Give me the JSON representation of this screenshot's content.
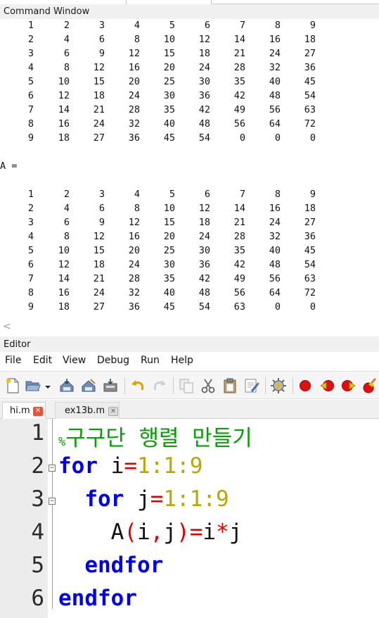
{
  "command_window": {
    "title": "Command Window",
    "matrix1": [
      [
        "1",
        "2",
        "3",
        "4",
        "5",
        "6",
        "7",
        "8",
        "9"
      ],
      [
        "2",
        "4",
        "6",
        "8",
        "10",
        "12",
        "14",
        "16",
        "18"
      ],
      [
        "3",
        "6",
        "9",
        "12",
        "15",
        "18",
        "21",
        "24",
        "27"
      ],
      [
        "4",
        "8",
        "12",
        "16",
        "20",
        "24",
        "28",
        "32",
        "36"
      ],
      [
        "5",
        "10",
        "15",
        "20",
        "25",
        "30",
        "35",
        "40",
        "45"
      ],
      [
        "6",
        "12",
        "18",
        "24",
        "30",
        "36",
        "42",
        "48",
        "54"
      ],
      [
        "7",
        "14",
        "21",
        "28",
        "35",
        "42",
        "49",
        "56",
        "63"
      ],
      [
        "8",
        "16",
        "24",
        "32",
        "40",
        "48",
        "56",
        "64",
        "72"
      ],
      [
        "9",
        "18",
        "27",
        "36",
        "45",
        "54",
        "0",
        "0",
        "0"
      ]
    ],
    "assign_label": "A =",
    "matrix2": [
      [
        "1",
        "2",
        "3",
        "4",
        "5",
        "6",
        "7",
        "8",
        "9"
      ],
      [
        "2",
        "4",
        "6",
        "8",
        "10",
        "12",
        "14",
        "16",
        "18"
      ],
      [
        "3",
        "6",
        "9",
        "12",
        "15",
        "18",
        "21",
        "24",
        "27"
      ],
      [
        "4",
        "8",
        "12",
        "16",
        "20",
        "24",
        "28",
        "32",
        "36"
      ],
      [
        "5",
        "10",
        "15",
        "20",
        "25",
        "30",
        "35",
        "40",
        "45"
      ],
      [
        "6",
        "12",
        "18",
        "24",
        "30",
        "36",
        "42",
        "48",
        "54"
      ],
      [
        "7",
        "14",
        "21",
        "28",
        "35",
        "42",
        "49",
        "56",
        "63"
      ],
      [
        "8",
        "16",
        "24",
        "32",
        "40",
        "48",
        "56",
        "64",
        "72"
      ],
      [
        "9",
        "18",
        "27",
        "36",
        "45",
        "54",
        "63",
        "0",
        "0"
      ]
    ],
    "scroll_left_icon": "chevron-left-icon"
  },
  "editor": {
    "title": "Editor",
    "menu": [
      "File",
      "Edit",
      "View",
      "Debug",
      "Run",
      "Help"
    ],
    "toolbar_icons": [
      "new-file-icon",
      "open-folder-icon",
      "dropdown-arrow-icon",
      "save-icon",
      "save-as-icon",
      "save-all-icon",
      "undo-icon",
      "redo-icon",
      "copy-icon",
      "cut-icon",
      "paste-icon",
      "find-icon",
      "run-settings-icon",
      "breakpoint-icon",
      "previous-breakpoint-icon",
      "next-breakpoint-icon",
      "clear-breakpoints-icon"
    ],
    "tabs": [
      {
        "label": "hi.m",
        "active": true,
        "close_icon": "close-icon"
      },
      {
        "label": "ex13b.m",
        "active": false,
        "close_icon": "close-icon"
      }
    ],
    "line_numbers": [
      "1",
      "2",
      "3",
      "4",
      "5",
      "6"
    ],
    "code": {
      "line1_comment_mark": "%",
      "line1_comment": "구구단 행렬 만들기",
      "kw_for": "for",
      "kw_endfor": "endfor",
      "var_i": "i",
      "var_j": "j",
      "var_A": "A",
      "op_eq": "=",
      "op_colon": ":",
      "op_mul": "*",
      "op_lparen": "(",
      "op_rparen": ")",
      "op_comma": ",",
      "num_1": "1",
      "num_9": "9"
    }
  },
  "colors": {
    "keyword": "#0000ee",
    "number": "#b5a800",
    "operator": "#e00000",
    "comment": "#0a9a0a",
    "tab_close_active": "#e8513a",
    "tab_close_inactive": "#c9c9c9"
  }
}
